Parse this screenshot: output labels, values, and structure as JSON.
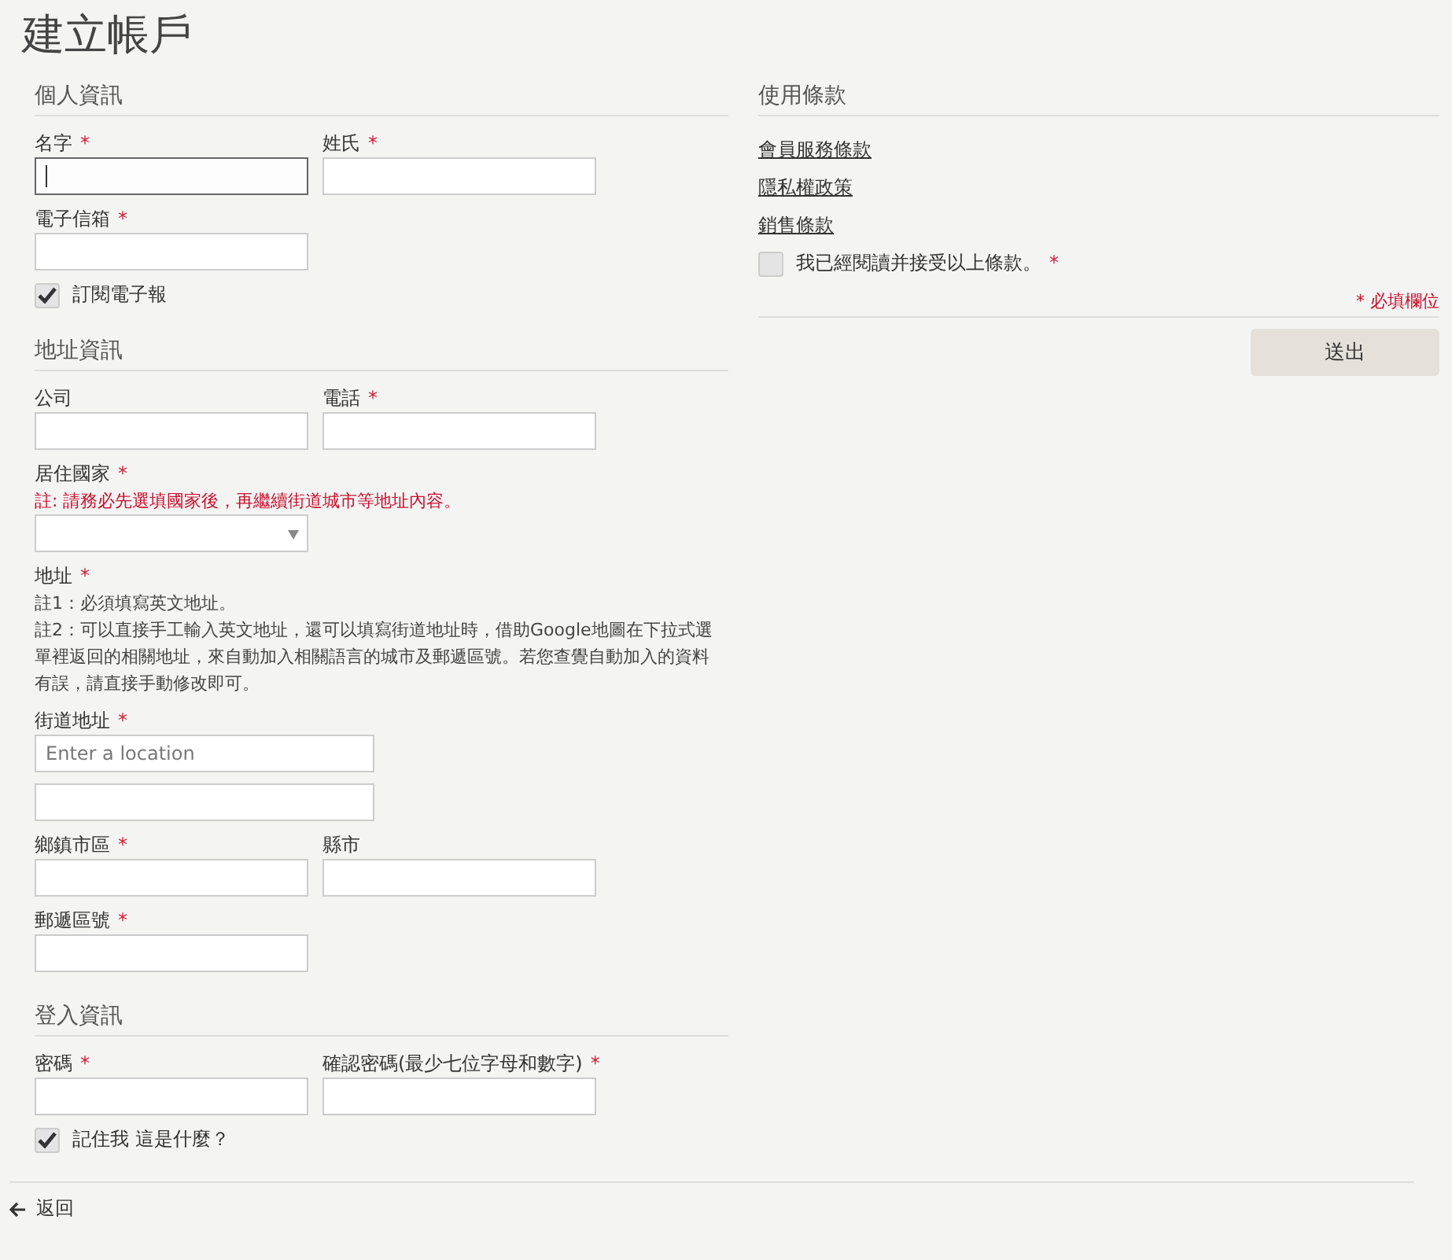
{
  "title": "建立帳戶",
  "required_mark": "*",
  "sections": [
    {
      "heading": "個人資訊",
      "blocks": [
        {
          "kind": "fields",
          "fields": [
            {
              "label": "名字",
              "required": true,
              "kind": "text",
              "focused": true
            },
            {
              "label": "姓氏",
              "required": true,
              "kind": "text",
              "focused": false
            }
          ]
        },
        {
          "kind": "fields",
          "fields": [
            {
              "label": "電子信箱",
              "required": true,
              "kind": "text",
              "focused": false
            }
          ]
        },
        {
          "kind": "checkbox",
          "label": "訂閱電子報",
          "checked": true
        }
      ]
    },
    {
      "heading": "地址資訊",
      "blocks": [
        {
          "kind": "fields",
          "fields": [
            {
              "label": "公司",
              "required": false,
              "kind": "text",
              "focused": false
            },
            {
              "label": "電話",
              "required": true,
              "kind": "text",
              "focused": false
            }
          ]
        },
        {
          "kind": "fields",
          "fields": [
            {
              "label": "居住國家",
              "required": true,
              "kind": "select",
              "notes": [
                {
                  "text": "註: 請務必先選填國家後，再繼續街道城市等地址內容。",
                  "kind": "warning"
                }
              ]
            }
          ]
        },
        {
          "kind": "fields",
          "fields": [
            {
              "label": "地址",
              "required": true,
              "kind": "none",
              "notes": [
                {
                  "text": "註1：必須填寫英文地址。",
                  "kind": "normal"
                },
                {
                  "text": "註2：可以直接手工輸入英文地址，還可以填寫街道地址時，借助Google地圖在下拉式選單裡返回的相關地址，來自動加入相關語言的城市及郵遞區號。若您查覺自動加入的資料有誤，請直接手動修改即可。",
                  "kind": "normal"
                }
              ]
            }
          ]
        },
        {
          "kind": "fields",
          "fields": [
            {
              "label": "街道地址",
              "required": true,
              "kind": "text",
              "wide": true,
              "focused": false,
              "placeholder": "Enter a location"
            }
          ]
        },
        {
          "kind": "fields",
          "fields": [
            {
              "kind": "text",
              "wide": true,
              "focused": false
            }
          ]
        },
        {
          "kind": "fields",
          "fields": [
            {
              "label": "鄉鎮市區",
              "required": true,
              "kind": "text",
              "focused": false
            },
            {
              "label": "縣市",
              "required": false,
              "kind": "text",
              "focused": false
            }
          ]
        },
        {
          "kind": "fields",
          "fields": [
            {
              "label": "郵遞區號",
              "required": true,
              "kind": "text",
              "focused": false
            }
          ]
        }
      ]
    },
    {
      "heading": "登入資訊",
      "blocks": [
        {
          "kind": "fields",
          "fields": [
            {
              "label": "密碼",
              "required": true,
              "kind": "text",
              "focused": false
            },
            {
              "label": "確認密碼(最少七位字母和數字)",
              "required": true,
              "kind": "text",
              "focused": false
            }
          ]
        },
        {
          "kind": "checkbox",
          "label": "記住我",
          "help": "這是什麼？",
          "checked": true
        }
      ]
    }
  ],
  "back_link": "返回",
  "terms": {
    "heading": "使用條款",
    "links": [
      "會員服務條款",
      "隱私權政策",
      "銷售條款"
    ],
    "agree": {
      "label": "我已經閱讀并接受以上條款。",
      "required": true,
      "checked": false
    },
    "required_note": "* 必填欄位",
    "submit": "送出"
  }
}
